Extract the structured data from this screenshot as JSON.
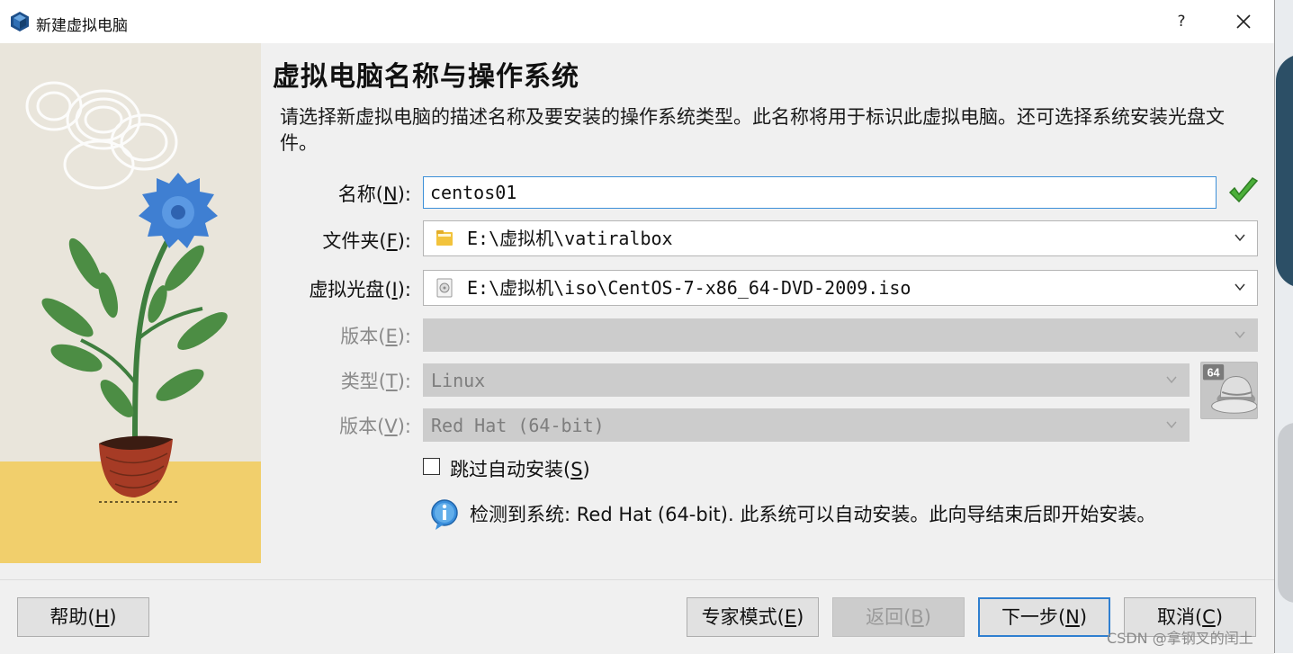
{
  "window": {
    "title": "新建虚拟电脑",
    "help_glyph": "?"
  },
  "page": {
    "heading": "虚拟电脑名称与操作系统",
    "description": "请选择新虚拟电脑的描述名称及要安装的操作系统类型。此名称将用于标识此虚拟电脑。还可选择系统安装光盘文件。"
  },
  "form": {
    "name": {
      "label": "名称",
      "accel": "N",
      "value": "centos01"
    },
    "folder": {
      "label": "文件夹",
      "accel": "F",
      "value": "E:\\虚拟机\\vatiralbox"
    },
    "iso": {
      "label": "虚拟光盘",
      "accel": "I",
      "value": "E:\\虚拟机\\iso\\CentOS-7-x86_64-DVD-2009.iso"
    },
    "edition": {
      "label": "版本",
      "accel": "E",
      "value": ""
    },
    "type": {
      "label": "类型",
      "accel": "T",
      "value": "Linux"
    },
    "version": {
      "label": "版本",
      "accel": "V",
      "value": "Red Hat (64-bit)"
    },
    "os_badge": "64",
    "skip_unattended": {
      "label": "跳过自动安装",
      "accel": "S",
      "checked": false
    },
    "info": "检测到系统: Red Hat (64-bit). 此系统可以自动安装。此向导结束后即开始安装。"
  },
  "buttons": {
    "help": {
      "label": "帮助",
      "accel": "H"
    },
    "expert": {
      "label": "专家模式",
      "accel": "E"
    },
    "back": {
      "label": "返回",
      "accel": "B"
    },
    "next": {
      "label": "下一步",
      "accel": "N"
    },
    "cancel": {
      "label": "取消",
      "accel": "C"
    }
  },
  "watermark": "CSDN @拿钢叉的闰土",
  "colors": {
    "accent": "#3c8fd8",
    "check_green": "#4caf3a",
    "disabled_fill": "#cccccc"
  }
}
